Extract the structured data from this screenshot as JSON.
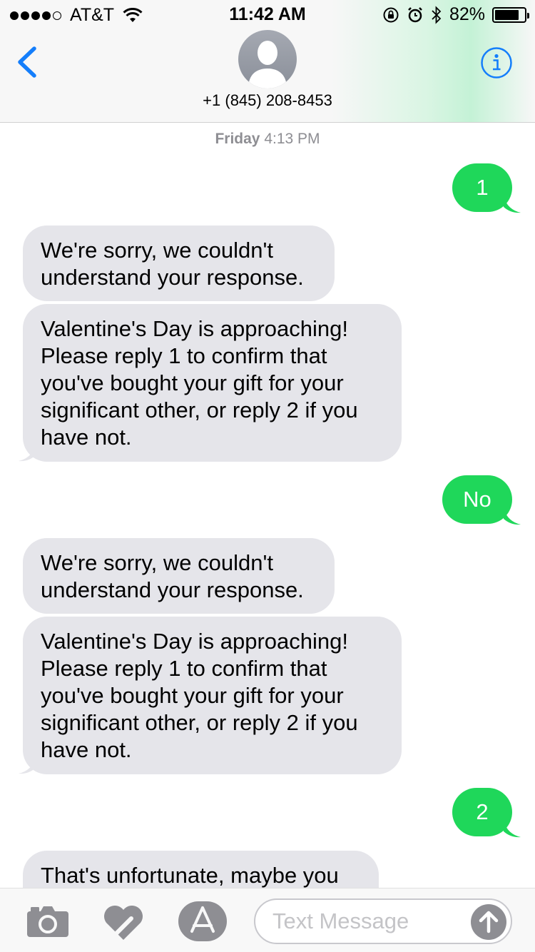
{
  "status_bar": {
    "carrier": "AT&T",
    "time": "11:42 AM",
    "battery": "82%",
    "battery_level": 0.82,
    "signal_bars": 4,
    "signal_max": 5
  },
  "header": {
    "contact": "+1 (845) 208-8453",
    "icons": [
      "back-chevron-icon",
      "contact-avatar",
      "info-icon"
    ],
    "accent_color": "#147efb"
  },
  "conversation": {
    "timestamp_day": "Friday",
    "timestamp_time": "4:13 PM",
    "messages": [
      {
        "direction": "outgoing",
        "text": "1"
      },
      {
        "direction": "incoming",
        "text": "We're sorry, we couldn't understand your response."
      },
      {
        "direction": "incoming",
        "text": "Valentine's Day is approaching! Please reply 1 to confirm that you've bought your gift for your significant other, or reply 2 if you have not."
      },
      {
        "direction": "outgoing",
        "text": "No"
      },
      {
        "direction": "incoming",
        "text": "We're sorry, we couldn't understand your response."
      },
      {
        "direction": "incoming",
        "text": "Valentine's Day is approaching! Please reply 1 to confirm that you've bought your gift for your significant other, or reply 2 if you have not."
      },
      {
        "direction": "outgoing",
        "text": "2"
      },
      {
        "direction": "incoming",
        "text": "That's unfortunate, maybe you"
      }
    ],
    "outgoing_color": "#1fd75a",
    "incoming_color": "#e5e5ea"
  },
  "toolbar": {
    "placeholder": "Text Message",
    "icons": [
      "camera-icon",
      "digital-touch-icon",
      "app-store-icon",
      "send-arrow-icon"
    ]
  }
}
